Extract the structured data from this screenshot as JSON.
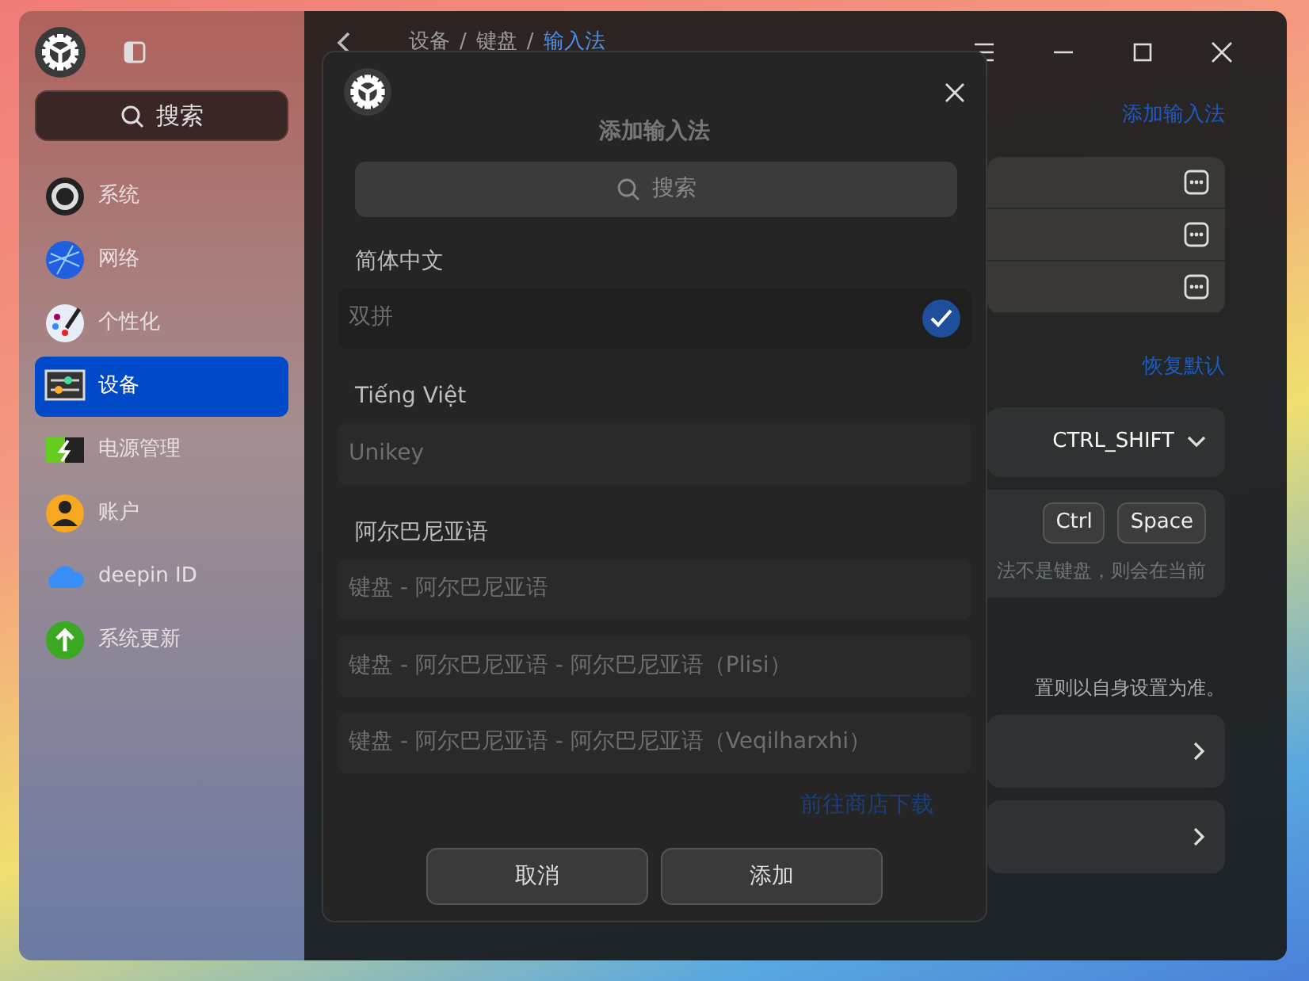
{
  "sidebar": {
    "search": {
      "placeholder": "搜索"
    },
    "items": [
      {
        "label": "系统",
        "selected": false
      },
      {
        "label": "网络",
        "selected": false
      },
      {
        "label": "个性化",
        "selected": false
      },
      {
        "label": "设备",
        "selected": true
      },
      {
        "label": "电源管理",
        "selected": false
      },
      {
        "label": "账户",
        "selected": false
      },
      {
        "label": "deepin ID",
        "selected": false
      },
      {
        "label": "系统更新",
        "selected": false
      }
    ]
  },
  "breadcrumb": [
    {
      "kind": "crumb",
      "text": "设备"
    },
    {
      "kind": "separator",
      "text": "/"
    },
    {
      "kind": "crumb",
      "text": "键盘"
    },
    {
      "kind": "separator",
      "text": "/"
    },
    {
      "kind": "current",
      "text": "输入法"
    }
  ],
  "page": {
    "add_link": "添加输入法",
    "restore_link": "恢复默认",
    "switch_shortcut": "CTRL_SHIFT",
    "shortcut_keys": [
      "Ctrl",
      "Space"
    ],
    "note_1": "法不是键盘，则会在当前",
    "note_2": "置则以自身设置为准。"
  },
  "dialog": {
    "title": "添加输入法",
    "search": {
      "placeholder": "搜索"
    },
    "groups": [
      {
        "heading": "简体中文",
        "items": [
          {
            "label": "双拼",
            "selected": true
          }
        ]
      },
      {
        "heading": "Tiếng Việt",
        "items": [
          {
            "label": "Unikey",
            "selected": false
          }
        ]
      },
      {
        "heading": "阿尔巴尼亚语",
        "items": [
          {
            "label": "键盘 - 阿尔巴尼亚语",
            "selected": false
          },
          {
            "label": "键盘 - 阿尔巴尼亚语 - 阿尔巴尼亚语（Plisi）",
            "selected": false
          },
          {
            "label": "键盘 - 阿尔巴尼亚语 - 阿尔巴尼亚语（Veqilharxhi）",
            "selected": false
          }
        ]
      }
    ],
    "store_link": "前往商店下载",
    "buttons": [
      "取消",
      "添加"
    ]
  }
}
